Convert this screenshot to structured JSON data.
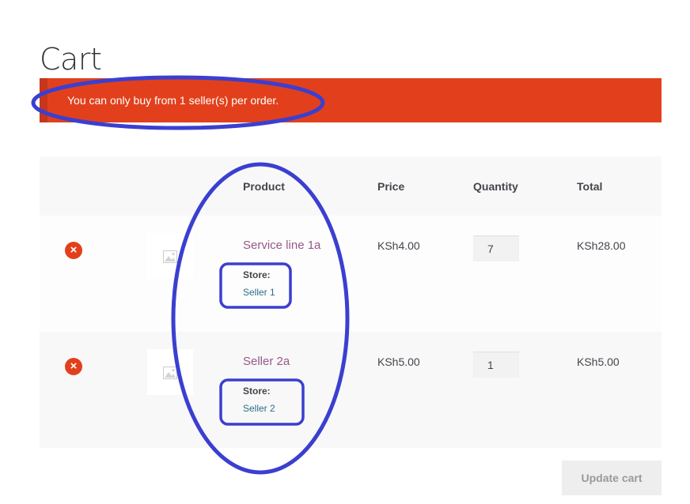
{
  "page": {
    "title": "Cart"
  },
  "notice": {
    "message": "You can only buy from 1 seller(s) per order."
  },
  "table": {
    "headers": {
      "product": "Product",
      "price": "Price",
      "quantity": "Quantity",
      "total": "Total"
    },
    "rows": [
      {
        "remove": "×",
        "product": "Service line 1a",
        "store_label": "Store:",
        "store": "Seller 1",
        "price": "KSh4.00",
        "quantity": "7",
        "total": "KSh28.00"
      },
      {
        "remove": "×",
        "product": "Seller 2a",
        "store_label": "Store:",
        "store": "Seller 2",
        "price": "KSh5.00",
        "quantity": "1",
        "total": "KSh5.00"
      }
    ]
  },
  "actions": {
    "update_cart": "Update cart"
  },
  "colors": {
    "notice_bg": "#e2401c",
    "product_link": "#96588a",
    "store_link": "#2c6e8a",
    "annotation": "#3b3fd0"
  }
}
